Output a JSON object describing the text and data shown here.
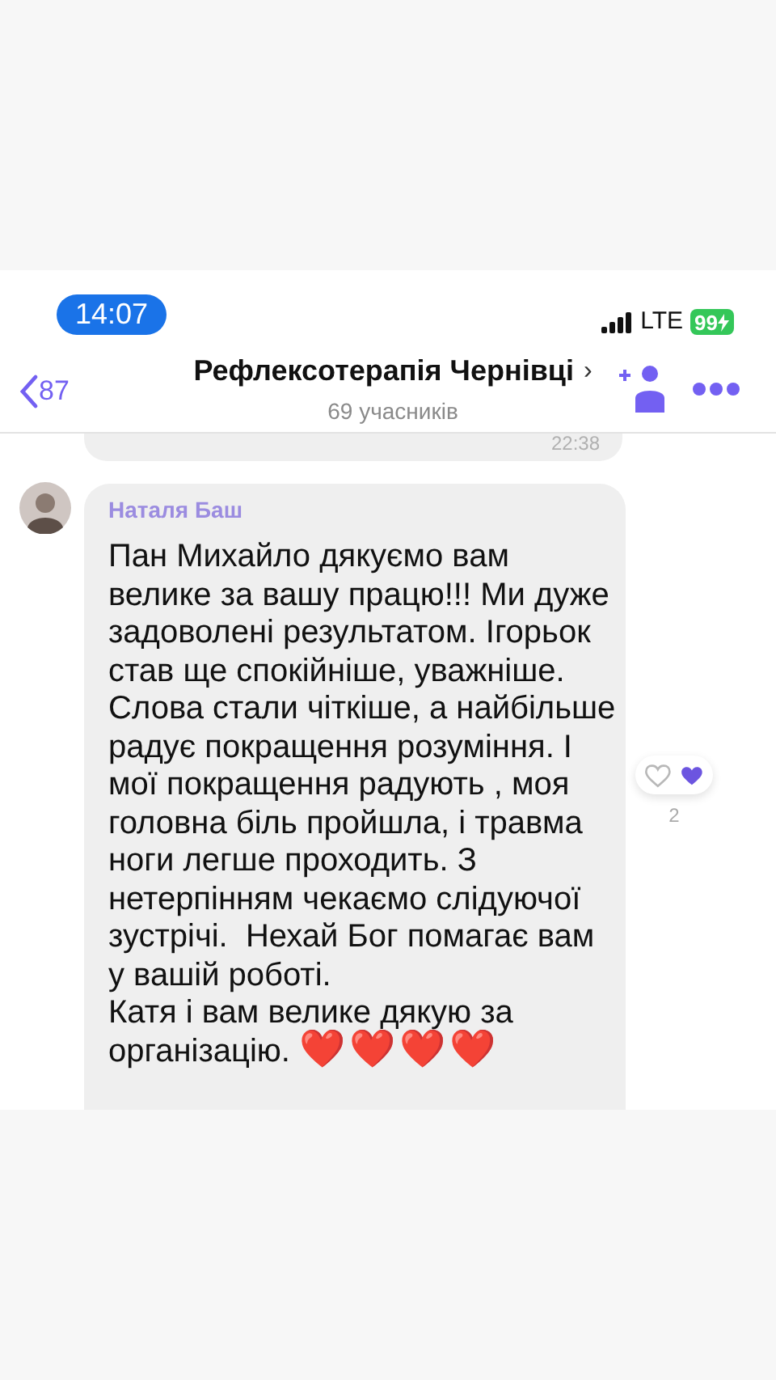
{
  "status_bar": {
    "time": "14:07",
    "network": "LTE",
    "battery": "99",
    "charging": true
  },
  "header": {
    "back_count": "87",
    "title": "Рефлексотерапія Чернівці",
    "title_chevron": "›",
    "subtitle": "69 учасників"
  },
  "messages": [
    {
      "kind": "tail",
      "time": "22:38"
    },
    {
      "kind": "full",
      "sender": "Наталя Баш",
      "text": "Пан Михайло дякуємо вам велике за вашу працю!!! Ми дуже задоволені результатом. Ігорьок став ще спокійніше, уважніше. Слова стали чіткіше, а найбільше радує покращення розуміння. І мої покращення радують , моя головна біль пройшла, і травма ноги легше проходить. З нетерпінням чекаємо слідуючої зустрічі.  Нехай Бог помагає вам у вашій роботі.\nКатя і вам велике дякую за організацію.",
      "emoji": "❤️❤️❤️❤️",
      "reactions": {
        "liked": false,
        "count": "2"
      }
    }
  ]
}
